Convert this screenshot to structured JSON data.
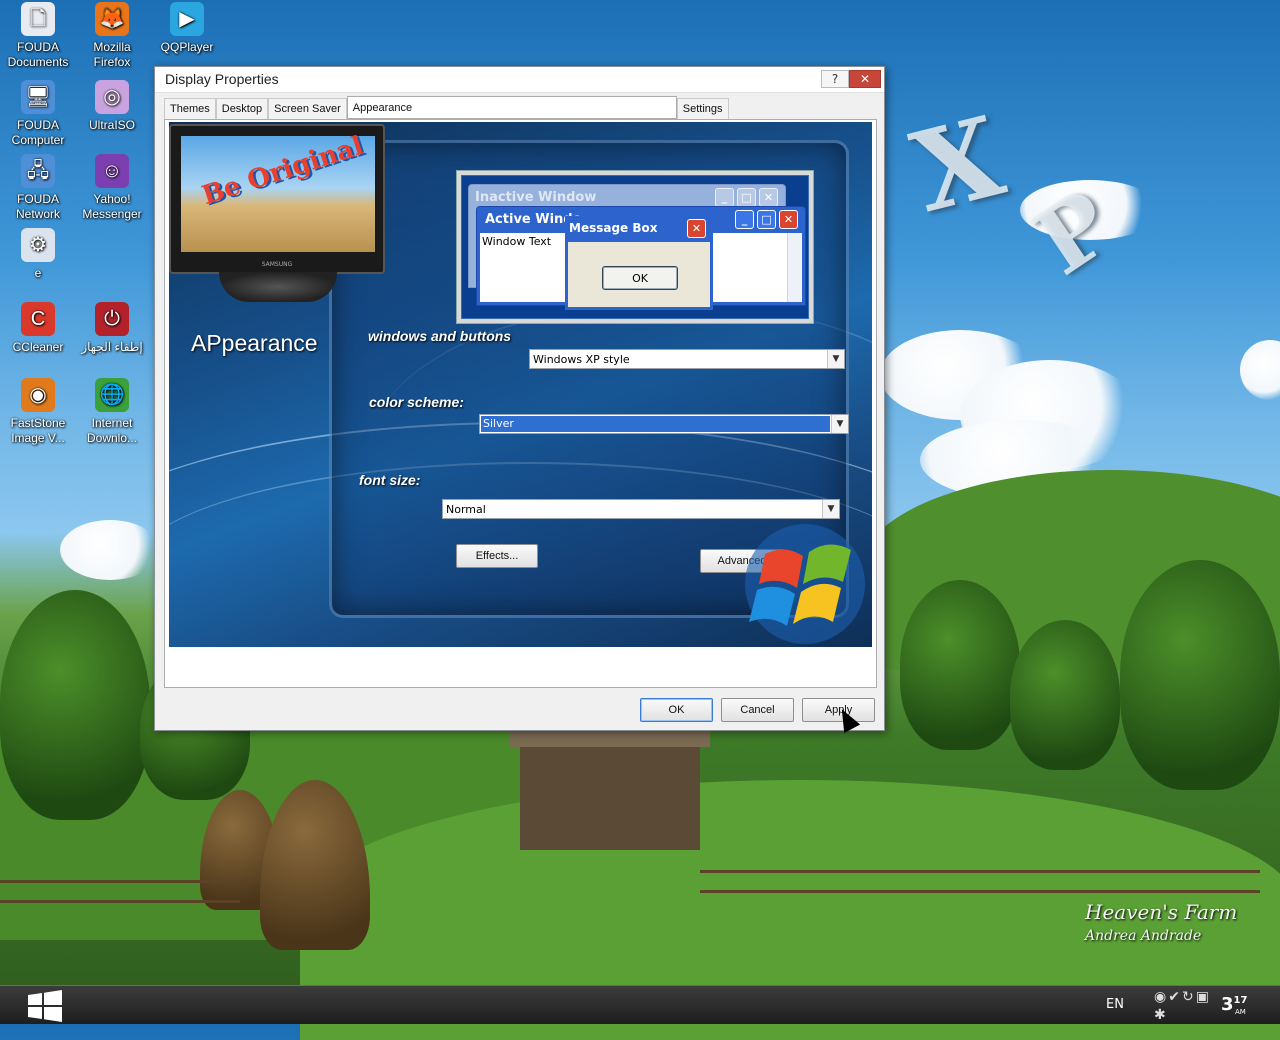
{
  "desktop": {
    "icons": [
      {
        "name": "fouda-documents-icon",
        "label": "FOUDA Documents",
        "glyph": "🗋",
        "color": "#e8ecf2"
      },
      {
        "name": "mozilla-firefox-icon",
        "label": "Mozilla Firefox",
        "glyph": "🦊",
        "color": "#e8751a"
      },
      {
        "name": "qqplayer-icon",
        "label": "QQPlayer",
        "glyph": "▶",
        "color": "#2aa6e0"
      },
      {
        "name": "fouda-computer-icon",
        "label": "FOUDA Computer",
        "glyph": "🖥",
        "color": "#4f8fd8"
      },
      {
        "name": "ultraiso-icon",
        "label": "UltraISO",
        "glyph": "◎",
        "color": "#c9a3e0"
      },
      {
        "name": "fouda-network-icon",
        "label": "FOUDA Network",
        "glyph": "🖧",
        "color": "#4f8fd8"
      },
      {
        "name": "yahoo-messenger-icon",
        "label": "Yahoo! Messenger",
        "glyph": "☺",
        "color": "#7b3fb0"
      },
      {
        "name": "e-icon",
        "label": "e",
        "glyph": "⚙",
        "color": "#dbe4ee"
      },
      {
        "name": "ccleaner-icon",
        "label": "CCleaner",
        "glyph": "C",
        "color": "#d8392b"
      },
      {
        "name": "shutdown-icon",
        "label": "إطفاء الجهاز",
        "glyph": "⏻",
        "color": "#b3222a"
      },
      {
        "name": "faststone-image-viewer-icon",
        "label": "FastStone Image V...",
        "glyph": "◉",
        "color": "#e07a1c"
      },
      {
        "name": "internet-download-manager-icon",
        "label": "Internet Downlo...",
        "glyph": "🌐",
        "color": "#3aa03c"
      }
    ],
    "decoration_text": {
      "x": "X",
      "p": "P"
    },
    "signature": {
      "line1": "Heaven's Farm",
      "line2": "Andrea Andrade"
    }
  },
  "dialog": {
    "title": "Display Properties",
    "help_label": "?",
    "close_label": "✕",
    "tabs": [
      "Themes",
      "Desktop",
      "Screen Saver",
      "Appearance",
      "Settings"
    ],
    "active_tab": "Appearance",
    "appearance": {
      "heading": "APpearance",
      "monitor_logo": "Be Original",
      "monitor_brand": "SAMSUNG",
      "preview": {
        "inactive_title": "Inactive Window",
        "active_title": "Active Windo",
        "window_text": "Window Text",
        "message_box_title": "Message Box",
        "message_box_ok": "OK"
      },
      "windows_and_buttons": {
        "label": "windows and buttons",
        "value": "Windows XP style"
      },
      "color_scheme": {
        "label": "color scheme:",
        "value": "Silver"
      },
      "font_size": {
        "label": "font size:",
        "value": "Normal"
      },
      "effects_button": "Effects...",
      "advanced_button": "Advanced"
    },
    "buttons": {
      "ok": "OK",
      "cancel": "Cancel",
      "apply": "Apply"
    }
  },
  "taskbar": {
    "language": "EN",
    "clock": {
      "hour": "3",
      "minute": "17",
      "ampm": "AM"
    }
  },
  "colors": {
    "dialog_bg": "#f0f0f0",
    "xp_blue": "#2d63cd",
    "close_red": "#c7463a",
    "taskbar": "#2a2a2a"
  }
}
